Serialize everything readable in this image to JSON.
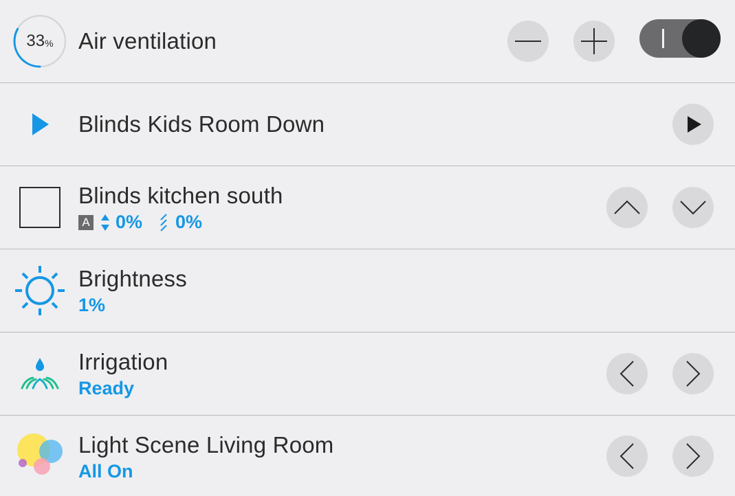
{
  "colors": {
    "accent": "#1597e5",
    "button_bg": "#d9d9db",
    "background": "#efeff1"
  },
  "rows": [
    {
      "id": "air-ventilation",
      "title": "Air ventilation",
      "percent_value": "33",
      "percent_unit": "%",
      "level": 0.33,
      "icon": "progress-ring-icon",
      "controls": [
        "minus-icon",
        "plus-icon",
        "toggle-switch"
      ],
      "toggle_on": true
    },
    {
      "id": "blinds-kids-room-down",
      "title": "Blinds Kids Room Down",
      "icon": "play-icon",
      "controls": [
        "play-icon"
      ]
    },
    {
      "id": "blinds-kitchen-south",
      "title": "Blinds kitchen south",
      "icon": "window-icon",
      "auto_badge": "A",
      "position_value": "0%",
      "slat_value": "0%",
      "controls": [
        "chevron-up-icon",
        "chevron-down-icon"
      ]
    },
    {
      "id": "brightness",
      "title": "Brightness",
      "value": "1%",
      "icon": "sun-icon"
    },
    {
      "id": "irrigation",
      "title": "Irrigation",
      "value": "Ready",
      "icon": "sprinkler-icon",
      "controls": [
        "chevron-left-icon",
        "chevron-right-icon"
      ]
    },
    {
      "id": "light-scene-living-room",
      "title": "Light Scene Living Room",
      "value": "All On",
      "icon": "color-bubbles-icon",
      "controls": [
        "chevron-left-icon",
        "chevron-right-icon"
      ]
    }
  ]
}
